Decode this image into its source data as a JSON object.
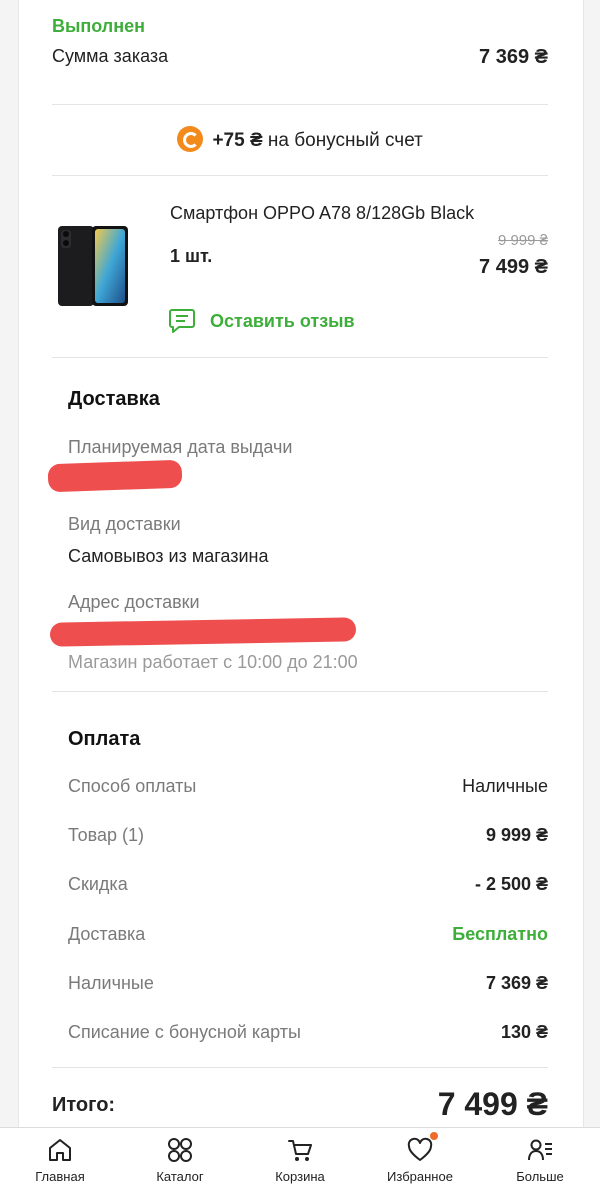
{
  "order": {
    "status": "Выполнен",
    "sum_label": "Сумма заказа",
    "sum_value": "7 369 ₴"
  },
  "bonus": {
    "amount": "+75 ₴",
    "text": "на бонусный счет",
    "icon": "bonus-coin-icon",
    "color": "#f28a1c"
  },
  "product": {
    "title": "Смартфон OPPO A78 8/128Gb Black",
    "qty": "1 шт.",
    "old_price": "9 999 ₴",
    "price": "7 499 ₴",
    "review_label": "Оставить отзыв"
  },
  "delivery": {
    "title": "Доставка",
    "date_label": "Планируемая дата выдачи",
    "type_label": "Вид доставки",
    "type_value": "Самовывоз из магазина",
    "address_label": "Адрес доставки",
    "hours": "Магазин работает с 10:00 до 21:00"
  },
  "payment": {
    "title": "Оплата",
    "rows": [
      {
        "label": "Способ оплаты",
        "value": "Наличные"
      },
      {
        "label": "Товар (1)",
        "value": "9 999 ₴"
      },
      {
        "label": "Скидка",
        "value": "- 2 500 ₴"
      },
      {
        "label": "Доставка",
        "value": "Бесплатно"
      },
      {
        "label": "Наличные",
        "value": "7 369 ₴"
      },
      {
        "label": "Списание с бонусной карты",
        "value": "130 ₴"
      }
    ]
  },
  "total": {
    "label": "Итого:",
    "value": "7 499 ₴"
  },
  "nav": [
    {
      "label": "Главная",
      "icon": "home-icon"
    },
    {
      "label": "Каталог",
      "icon": "catalog-icon"
    },
    {
      "label": "Корзина",
      "icon": "cart-icon"
    },
    {
      "label": "Избранное",
      "icon": "heart-icon"
    },
    {
      "label": "Больше",
      "icon": "more-icon"
    }
  ],
  "colors": {
    "accent_green": "#3eae3a",
    "redaction": "#ee4e4e",
    "notification_dot": "#f06a28"
  }
}
